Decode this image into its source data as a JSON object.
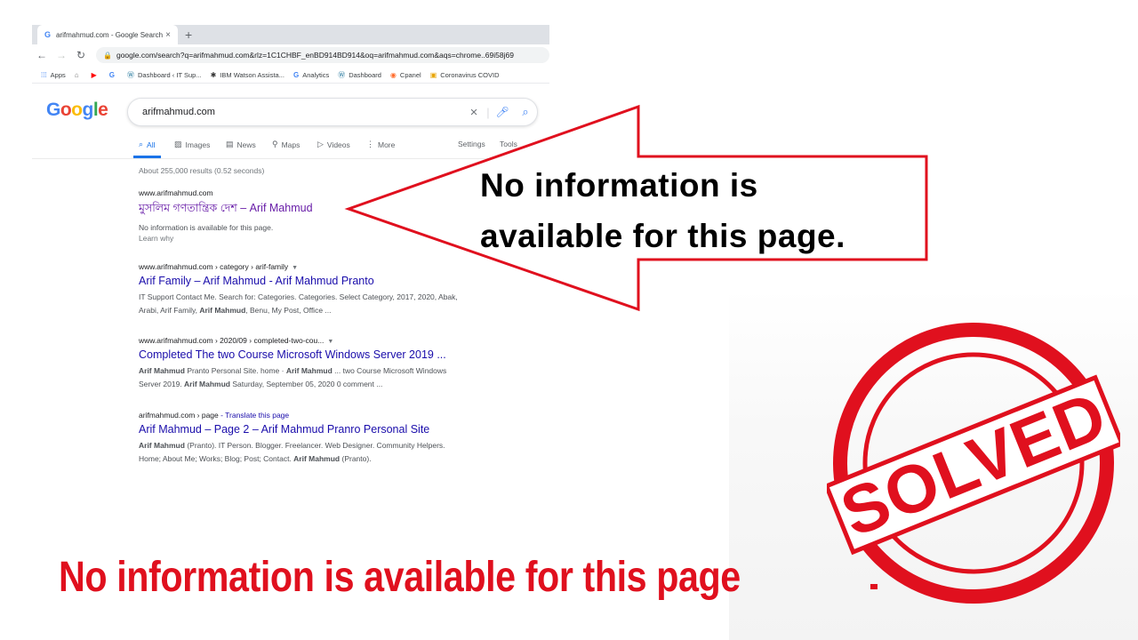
{
  "browser": {
    "tab_title": "arifmahmud.com - Google Search",
    "tab_close": "×",
    "new_tab": "+",
    "url": "google.com/search?q=arifmahmud.com&rlz=1C1CHBF_enBD914BD914&oq=arifmahmud.com&aqs=chrome..69i58j69",
    "bookmarks": [
      {
        "label": "Apps",
        "icon": "apps-grid-icon"
      },
      {
        "label": "",
        "icon": "home-icon"
      },
      {
        "label": "",
        "icon": "youtube-icon"
      },
      {
        "label": "",
        "icon": "google-icon"
      },
      {
        "label": "Dashboard ‹ IT Sup...",
        "icon": "wordpress-icon"
      },
      {
        "label": "IBM Watson Assista...",
        "icon": "ibm-watson-icon"
      },
      {
        "label": "Analytics",
        "icon": "google-icon"
      },
      {
        "label": "Dashboard",
        "icon": "wordpress-icon"
      },
      {
        "label": "Cpanel",
        "icon": "cpanel-icon"
      },
      {
        "label": "Coronavirus COVID",
        "icon": "covid-icon"
      }
    ]
  },
  "google": {
    "logo": "Google",
    "query": "arifmahmud.com",
    "tabs": [
      "All",
      "Images",
      "News",
      "Maps",
      "Videos",
      "More"
    ],
    "settings": "Settings",
    "tools": "Tools",
    "stats": "About 255,000 results (0.52 seconds)",
    "results": [
      {
        "url": "www.arifmahmud.com",
        "title": "মুসলিম গণতান্ত্রিক দেশ – Arif Mahmud",
        "snippet": "No information is available for this page.",
        "learn": "Learn why"
      },
      {
        "url": "www.arifmahmud.com › category › arif-family",
        "title": "Arif Family – Arif Mahmud - Arif Mahmud Pranto",
        "snippet_line1": "IT Support Contact Me. Search for: Categories. Categories. Select Category, 2017, 2020, Abak,",
        "snippet_line2_a": "Arabi, Arif Family, ",
        "snippet_line2_b": "Arif Mahmud",
        "snippet_line2_c": ", Benu, My Post, Office ..."
      },
      {
        "url": "www.arifmahmud.com › 2020/09 › completed-two-cou...",
        "title": "Completed The two Course Microsoft Windows Server 2019 ...",
        "s1_b1": "Arif Mahmud",
        "s1_t1": " Pranto Personal Site. home · ",
        "s1_b2": "Arif Mahmud",
        "s1_t2": " ... two Course Microsoft Windows",
        "s2_t1": "Server 2019. ",
        "s2_b1": "Arif Mahmud",
        "s2_t2": " Saturday, September 05, 2020 0 comment ..."
      },
      {
        "url": "arifmahmud.com › page",
        "translate": " - Translate this page",
        "title": "Arif Mahmud – Page 2 – Arif Mahmud Pranro Personal Site",
        "s1_b1": "Arif Mahmud",
        "s1_t1": " (Pranto). IT Person. Blogger. Freelancer. Web Designer. Community Helpers.",
        "s2_t1": "Home; About Me; Works; Blog; Post; Contact. ",
        "s2_b1": "Arif Mahmud",
        "s2_t2": " (Pranto)."
      }
    ]
  },
  "overlay": {
    "callout_line1": "No information is",
    "callout_line2": "available for this page.",
    "bottom_caption": "No information is available for this page",
    "stamp_text": "SOLVED",
    "accent_color": "#e0101e"
  }
}
